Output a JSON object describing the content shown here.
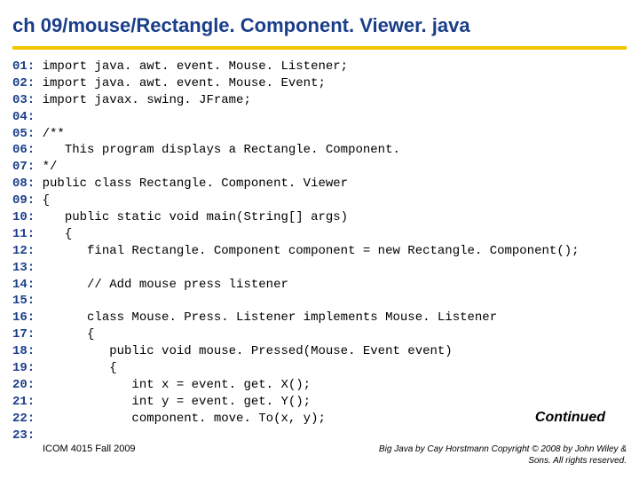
{
  "title": "ch 09/mouse/Rectangle. Component. Viewer. java",
  "code": [
    {
      "n": "01:",
      "t": " import java. awt. event. Mouse. Listener;"
    },
    {
      "n": "02:",
      "t": " import java. awt. event. Mouse. Event;"
    },
    {
      "n": "03:",
      "t": " import javax. swing. JFrame;"
    },
    {
      "n": "04:",
      "t": ""
    },
    {
      "n": "05:",
      "t": " /**"
    },
    {
      "n": "06:",
      "t": "    This program displays a Rectangle. Component."
    },
    {
      "n": "07:",
      "t": " */"
    },
    {
      "n": "08:",
      "t": " public class Rectangle. Component. Viewer"
    },
    {
      "n": "09:",
      "t": " {"
    },
    {
      "n": "10:",
      "t": "    public static void main(String[] args)"
    },
    {
      "n": "11:",
      "t": "    {"
    },
    {
      "n": "12:",
      "t": "       final Rectangle. Component component = new Rectangle. Component();"
    },
    {
      "n": "13:",
      "t": ""
    },
    {
      "n": "14:",
      "t": "       // Add mouse press listener"
    },
    {
      "n": "15:",
      "t": ""
    },
    {
      "n": "16:",
      "t": "       class Mouse. Press. Listener implements Mouse. Listener"
    },
    {
      "n": "17:",
      "t": "       {"
    },
    {
      "n": "18:",
      "t": "          public void mouse. Pressed(Mouse. Event event)"
    },
    {
      "n": "19:",
      "t": "          {"
    },
    {
      "n": "20:",
      "t": "             int x = event. get. X();"
    },
    {
      "n": "21:",
      "t": "             int y = event. get. Y();"
    },
    {
      "n": "22:",
      "t": "             component. move. To(x, y);"
    },
    {
      "n": "23:",
      "t": ""
    }
  ],
  "continued": "Continued",
  "footer_left": "ICOM 4015 Fall 2009",
  "footer_right": "Big Java by Cay Horstmann Copyright © 2008 by John Wiley & Sons.  All rights reserved."
}
